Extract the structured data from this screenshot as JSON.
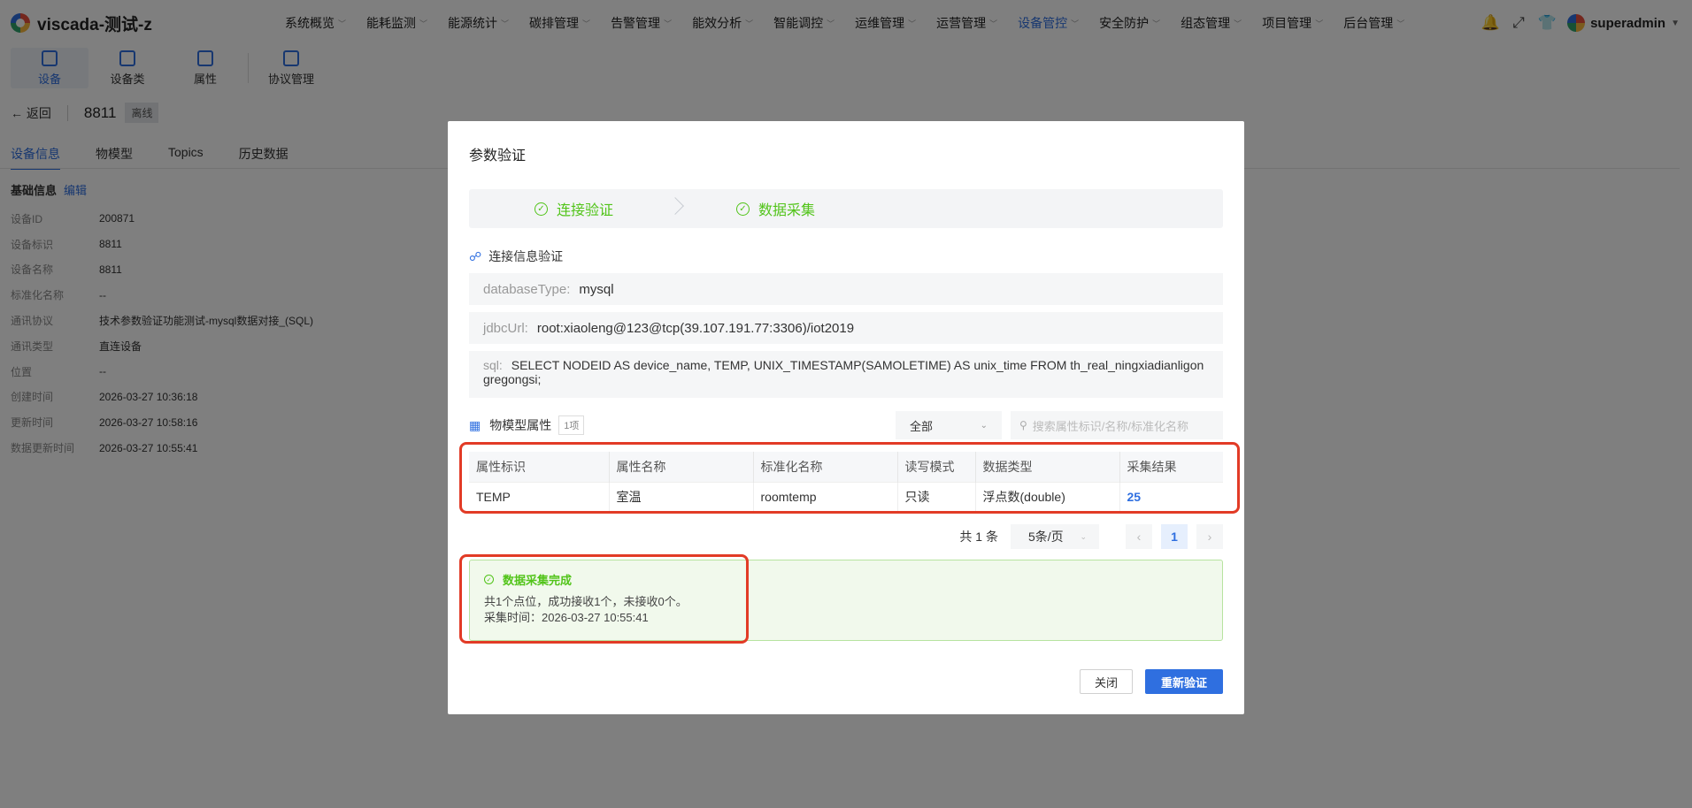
{
  "app": {
    "title": "viscada-测试-z"
  },
  "nav": {
    "items": [
      "系统概览",
      "能耗监测",
      "能源统计",
      "碳排管理",
      "告警管理",
      "能效分析",
      "智能调控",
      "运维管理",
      "运营管理",
      "设备管控",
      "安全防护",
      "组态管理",
      "项目管理",
      "后台管理"
    ],
    "active_index": 9
  },
  "user": {
    "name": "superadmin"
  },
  "subbar": {
    "items": [
      "设备",
      "设备类",
      "属性",
      "协议管理"
    ]
  },
  "device": {
    "back_label": "返回",
    "name": "8811",
    "status": "离线"
  },
  "tabs": [
    "设备信息",
    "物模型",
    "Topics",
    "历史数据"
  ],
  "basic": {
    "title": "基础信息",
    "edit": "编辑",
    "rows": [
      {
        "k": "设备ID",
        "v": "200871"
      },
      {
        "k": "设备标识",
        "v": "8811"
      },
      {
        "k": "设备名称",
        "v": "8811"
      },
      {
        "k": "标准化名称",
        "v": "--"
      },
      {
        "k": "通讯协议",
        "v": "技术参数验证功能测试-mysql数据对接_(SQL)"
      },
      {
        "k": "通讯类型",
        "v": "直连设备"
      },
      {
        "k": "位置",
        "v": "--"
      },
      {
        "k": "创建时间",
        "v": "2026-03-27 10:36:18"
      },
      {
        "k": "更新时间",
        "v": "2026-03-27 10:58:16"
      },
      {
        "k": "数据更新时间",
        "v": "2026-03-27 10:55:41"
      }
    ]
  },
  "modal": {
    "title": "参数验证",
    "steps": [
      "连接验证",
      "数据采集"
    ],
    "conn_title": "连接信息验证",
    "fields": {
      "database_type": {
        "label": "databaseType:",
        "value": "mysql"
      },
      "jdbc_url": {
        "label": "jdbcUrl:",
        "value": "root:xiaoleng@123@tcp(39.107.191.77:3306)/iot2019"
      },
      "sql": {
        "label": "sql:",
        "value": "SELECT NODEID AS device_name, TEMP, UNIX_TIMESTAMP(SAMOLETIME) AS unix_time FROM th_real_ningxiadianligongregongsi;"
      }
    },
    "props_title": "物模型属性",
    "props_count": "1项",
    "filter_value": "全部",
    "search_placeholder": "搜索属性标识/名称/标准化名称",
    "table": {
      "headers": [
        "属性标识",
        "属性名称",
        "标准化名称",
        "读写模式",
        "数据类型",
        "采集结果"
      ],
      "rows": [
        [
          "TEMP",
          "室温",
          "roomtemp",
          "只读",
          "浮点数(double)",
          "25"
        ]
      ]
    },
    "pager": {
      "total": "共 1 条",
      "page_size": "5条/页",
      "current": "1"
    },
    "result": {
      "title": "数据采集完成",
      "line1": "共1个点位，成功接收1个，未接收0个。",
      "line2": "采集时间：2026-03-27 10:55:41"
    },
    "buttons": {
      "close": "关闭",
      "revalidate": "重新验证"
    }
  },
  "colors": {
    "accent": "#2f6fe0",
    "success": "#52c41a",
    "highlight": "#e23b26"
  }
}
